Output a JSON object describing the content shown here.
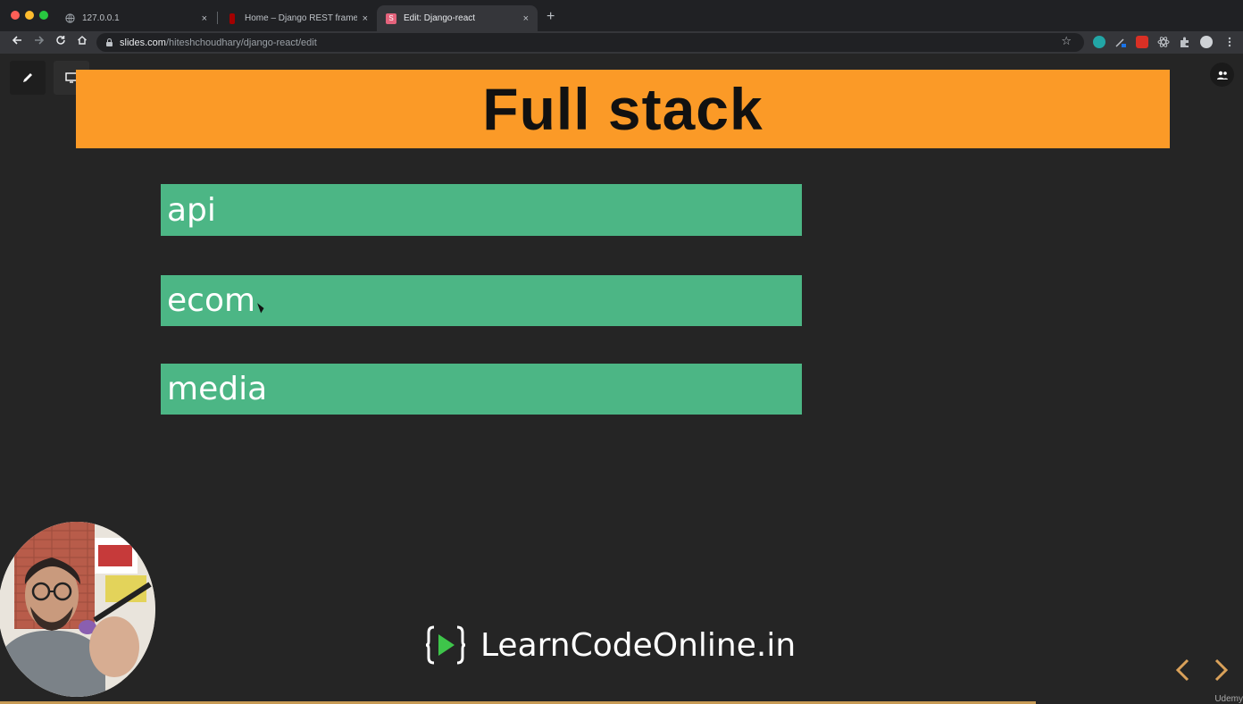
{
  "browser": {
    "tabs": [
      {
        "title": "127.0.0.1",
        "active": false
      },
      {
        "title": "Home – Django REST framewo",
        "active": false
      },
      {
        "title": "Edit: Django-react",
        "active": true,
        "favicon_letter": "S"
      }
    ],
    "close_glyph": "×",
    "new_tab_glyph": "+",
    "url_host": "slides.com",
    "url_path": "/hiteshchoudhary/django-react/edit"
  },
  "slide": {
    "title": "Full stack",
    "blocks": [
      "api",
      "ecom",
      "media"
    ]
  },
  "brand": {
    "text": "LearnCodeOnline.in"
  },
  "footer": {
    "watermark": "Udemy"
  },
  "colors": {
    "title_bg": "#fb9a27",
    "block_bg": "#4cb685",
    "stage_bg": "#252525",
    "brand_play": "#3ec54a",
    "nav_arrow": "#d9a15a"
  }
}
